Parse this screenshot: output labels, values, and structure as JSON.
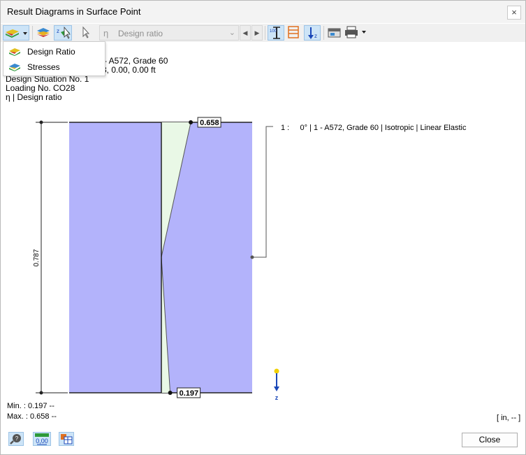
{
  "window": {
    "title": "Result Diagrams in Surface Point",
    "close_glyph": "×"
  },
  "toolbar": {
    "combo_symbol": "η",
    "combo_value": "Design ratio"
  },
  "dropdown": {
    "items": [
      {
        "label": "Design Ratio"
      },
      {
        "label": "Stresses"
      }
    ]
  },
  "info": {
    "line1_partial": "- A572, Grade 60",
    "line2_partial": "3, 0.00, 0.00 ft",
    "design_situation": "Design Situation No. 1",
    "loading": "Loading No. CO28",
    "quantity": "η | Design ratio"
  },
  "chart_data": {
    "type": "area",
    "title": "",
    "thickness_label": "0.787",
    "top_value": 0.658,
    "bottom_value": 0.197,
    "top_label": "0.658",
    "bottom_label": "0.197",
    "axis_label": "z",
    "legend": "1 :     0° | 1 - A572, Grade 60 | Isotropic | Linear Elastic",
    "colors": {
      "layer_fill": "#b3b3fb",
      "diagram_fill": "#e9f8e6",
      "axis_arrow": "#1a47b8",
      "axis_dot": "#f0d000"
    }
  },
  "footer": {
    "min": "Min. : 0.197 --",
    "max": "Max. : 0.658 --",
    "units": "[ in, -- ]"
  },
  "buttons": {
    "close": "Close"
  }
}
